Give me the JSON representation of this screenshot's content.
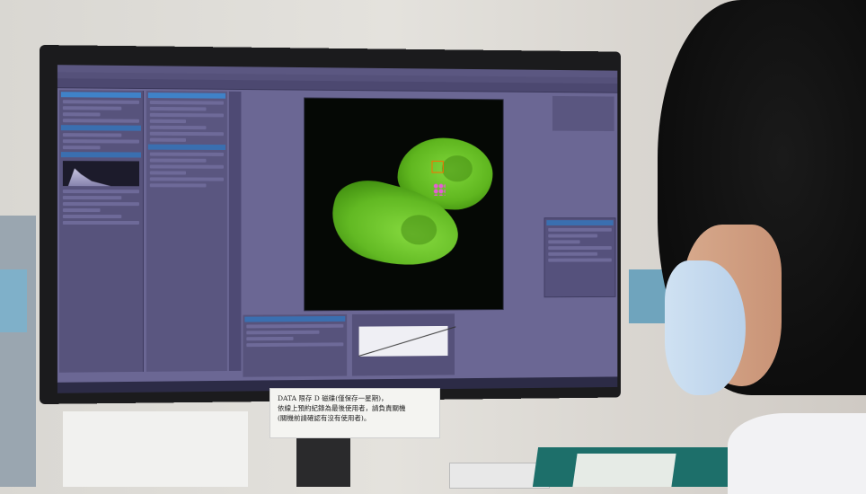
{
  "notices": {
    "center": {
      "line1": "DATA 限存 D 磁碟(僅保存一星期)，",
      "line2": "依線上預約紀錄為最後使用者，請負責關機",
      "line3": "(關機前請確認有沒有使用者)。"
    }
  },
  "colors": {
    "screen_ui": "#6b6794",
    "panel_header_blue": "#3f82c8",
    "cell_green": "#6ac72a",
    "binder_teal": "#1d6f6a"
  },
  "icons": [
    "monitor",
    "microscope-image",
    "histogram",
    "lut-curve"
  ]
}
